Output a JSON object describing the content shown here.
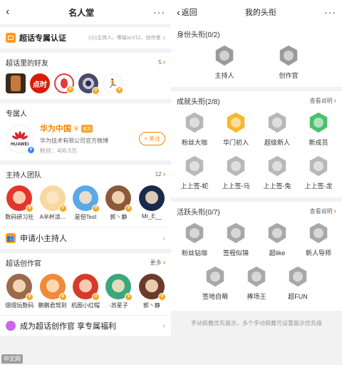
{
  "left": {
    "title": "名人堂",
    "certify": {
      "label": "超话专属认证",
      "hint": "(小)主持人、等级≥LV12、创作官"
    },
    "friends": {
      "title": "超话里的好友",
      "count": "5",
      "items": [
        {
          "color": "#b86b2e"
        },
        {
          "color": "#d81e06",
          "text": "点时"
        },
        {
          "color": "#e83838"
        },
        {
          "color": "#6a6a8a"
        },
        {
          "color": "#ffffff"
        }
      ]
    },
    "exclusive": {
      "title": "专属人",
      "name": "华为中国",
      "tag": "官方",
      "desc": "华为技术有限公司官方微博",
      "fans": "粉丝：406.5万",
      "follow": "+ 关注",
      "logo_text": "HUAWEI"
    },
    "hosts": {
      "title": "主持人团队",
      "count": "12",
      "items": [
        {
          "name": "数码研习社",
          "color": "#e4352c"
        },
        {
          "name": "A半杯凉...",
          "color": "#f7d9a0"
        },
        {
          "name": "是但Test",
          "color": "#5aa8e8"
        },
        {
          "name": "郭丶静",
          "color": "#8a5a3a"
        },
        {
          "name": "Mr_E__",
          "color": "#1a2a4a"
        }
      ]
    },
    "apply": "申请小主持人",
    "creators": {
      "title": "超话创作官",
      "more": "更多",
      "items": [
        {
          "name": "熠熠玩数码",
          "color": "#9a6a4a"
        },
        {
          "name": "鹏鹏君驾到",
          "color": "#f08a3a"
        },
        {
          "name": "机圈小红帽",
          "color": "#d83a2a"
        },
        {
          "name": "-苏星子",
          "color": "#3aa87a"
        },
        {
          "name": "郭丶静",
          "color": "#6a3a2a"
        }
      ]
    },
    "become": "成为超话创作官 享专属福利"
  },
  "right": {
    "back": "返回",
    "title": "我的头衔",
    "identity": {
      "title": "身份头衔(0/2)",
      "items": [
        {
          "label": "主持人"
        },
        {
          "label": "创作官"
        }
      ]
    },
    "achievement": {
      "title": "成就头衔(2/8)",
      "more": "查看说明",
      "items": [
        {
          "label": "粉丝大咖",
          "color": "#b8b8b8"
        },
        {
          "label": "华门初入",
          "color": "#f5b92a"
        },
        {
          "label": "超级新人",
          "color": "#b8b8b8"
        },
        {
          "label": "新成员",
          "color": "#4cc06a"
        },
        {
          "label": "上上签-蛇",
          "color": "#b8b8b8"
        },
        {
          "label": "上上签-马",
          "color": "#b8b8b8"
        },
        {
          "label": "上上签-兔",
          "color": "#b8b8b8"
        },
        {
          "label": "上上签-龙",
          "color": "#b8b8b8"
        }
      ]
    },
    "activity": {
      "title": "活跃头衔(0/7)",
      "more": "查看说明",
      "items": [
        {
          "label": "粉丝钻咖"
        },
        {
          "label": "签程似锦"
        },
        {
          "label": "超like"
        },
        {
          "label": "新人导师"
        },
        {
          "label": "签地自萌"
        },
        {
          "label": "捧场王"
        },
        {
          "label": "超FUN"
        }
      ]
    },
    "footer": "手动佩戴优先展示，多个手动佩戴可设置展示优先级"
  },
  "watermark": "中文网"
}
